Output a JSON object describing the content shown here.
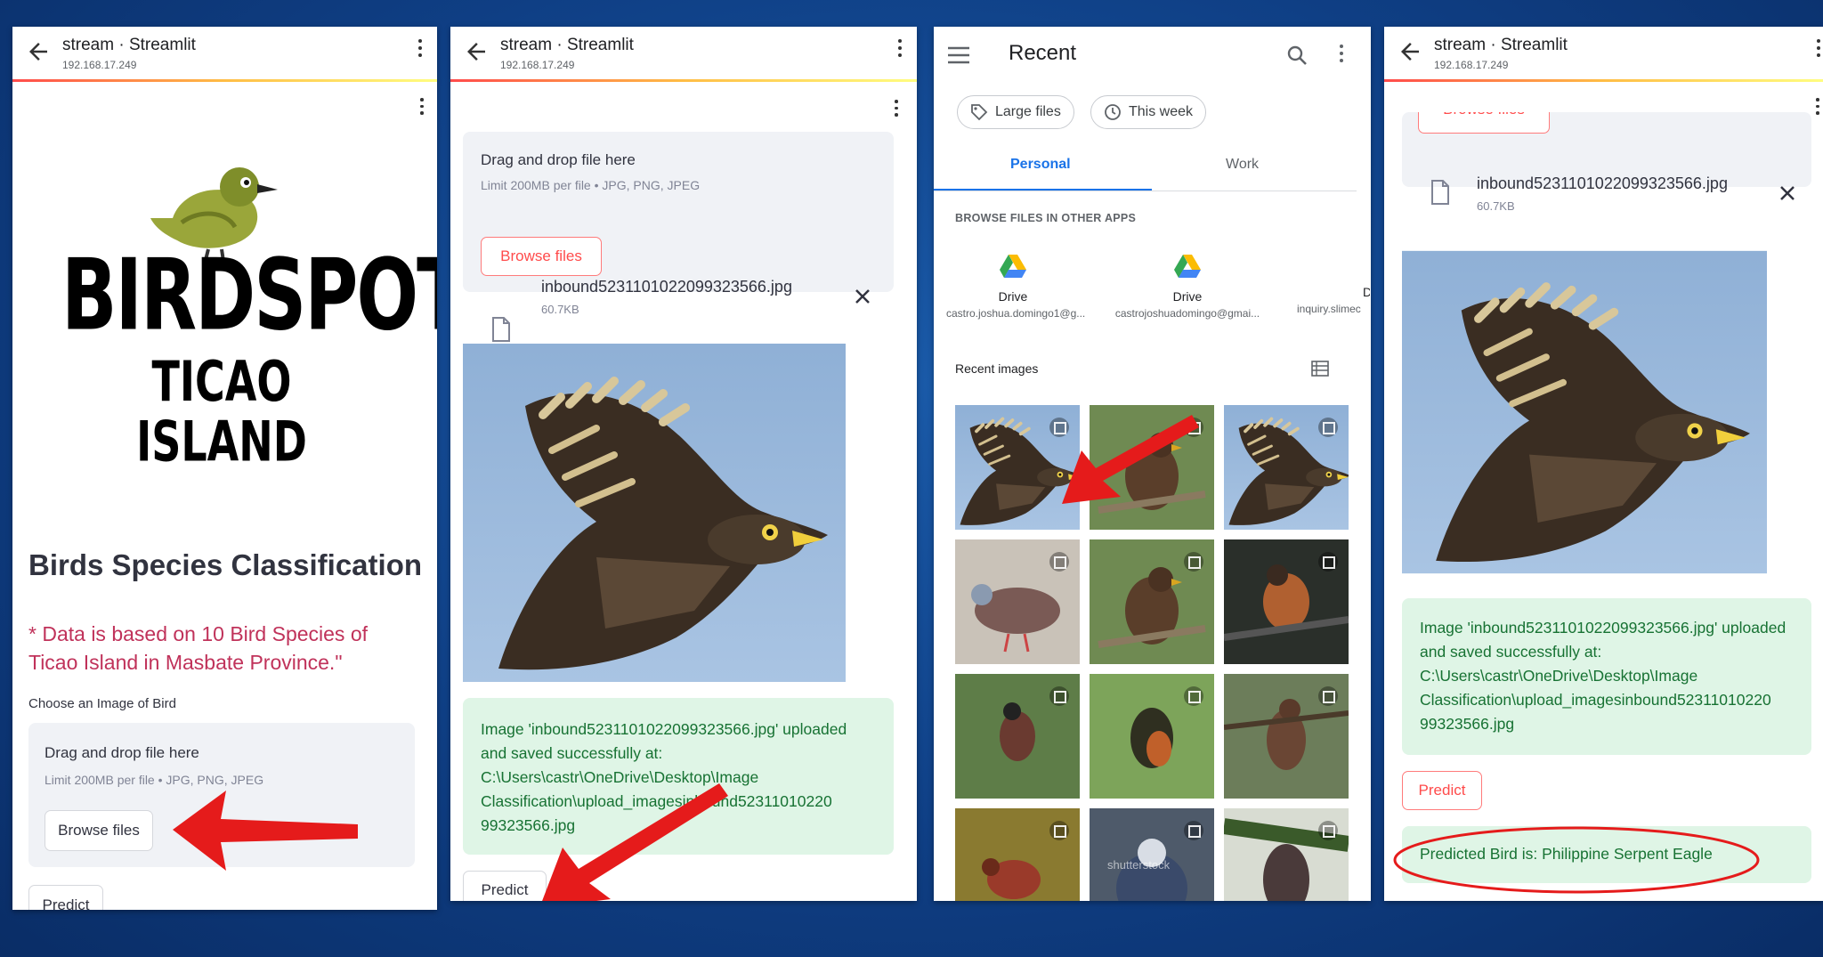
{
  "browser": {
    "title": "stream · Streamlit",
    "url": "192.168.17.249"
  },
  "panel1": {
    "logo_main": "BIRDSPOT",
    "logo_sub": "TICAO ISLAND",
    "heading": "Birds Species Classification",
    "note": "* Data is based on 10 Bird Species of Ticao Island in Masbate Province.\"",
    "choose_label": "Choose an Image of Bird",
    "drop_title": "Drag and drop file here",
    "drop_limit": "Limit 200MB per file • JPG, PNG, JPEG",
    "browse_label": "Browse files",
    "predict_label": "Predict"
  },
  "panel2": {
    "drop_title": "Drag and drop file here",
    "drop_limit": "Limit 200MB per file • JPG, PNG, JPEG",
    "browse_label": "Browse files",
    "file_name": "inbound5231101022099323566.jpg",
    "file_size": "60.7KB",
    "success_text": "Image 'inbound5231101022099323566.jpg' uploaded and saved successfully at: C:\\Users\\castr\\OneDrive\\Desktop\\Image Classification\\upload_imagesinbound52311010220 99323566.jpg",
    "predict_label": "Predict"
  },
  "panel3": {
    "title": "Recent",
    "chips": [
      {
        "label": "Large files",
        "icon": "tag-icon"
      },
      {
        "label": "This week",
        "icon": "history-icon"
      }
    ],
    "tabs": [
      "Personal",
      "Work"
    ],
    "section_label": "BROWSE FILES IN OTHER APPS",
    "apps": [
      {
        "name": "Drive",
        "account": "castro.joshua.domingo1@g..."
      },
      {
        "name": "Drive",
        "account": "castrojoshuadomingo@gmai..."
      },
      {
        "name": "D",
        "account": "inquiry.slimec"
      }
    ],
    "recent_label": "Recent images",
    "watermark": "shutterstock"
  },
  "panel4": {
    "browse_partial": "Browse files",
    "file_name": "inbound5231101022099323566.jpg",
    "file_size": "60.7KB",
    "success_text": "Image 'inbound5231101022099323566.jpg' uploaded and saved successfully at: C:\\Users\\castr\\OneDrive\\Desktop\\Image Classification\\upload_imagesinbound52311010220 99323566.jpg",
    "predict_label": "Predict",
    "result_text": "Predicted Bird is: Philippine Serpent Eagle"
  },
  "colors": {
    "background": "#0f3f85",
    "streamlit_red": "#ff4b4b",
    "success_bg": "#dff5e6",
    "success_text": "#177233",
    "tab_accent": "#1a73e8",
    "annotation_red": "#e51b1b"
  }
}
